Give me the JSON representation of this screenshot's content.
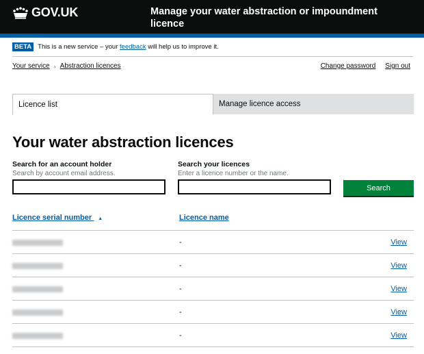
{
  "header": {
    "logo_text": "GOV.UK",
    "service_name": "Manage your water abstraction or impoundment licence"
  },
  "phase_banner": {
    "tag": "BETA",
    "text_before": "This is a new service – your",
    "link": "feedback",
    "text_after": "will help us to improve it."
  },
  "breadcrumbs": [
    "Your service",
    "Abstraction licences"
  ],
  "account_links": {
    "change_password": "Change password",
    "sign_out": "Sign out"
  },
  "tabs": [
    {
      "label": "Licence list",
      "active": true
    },
    {
      "label": "Manage licence access",
      "active": false
    }
  ],
  "page_title": "Your water abstraction licences",
  "search": {
    "account_label": "Search for an account holder",
    "account_hint": "Search by account email address.",
    "account_value": "",
    "licence_label": "Search your licences",
    "licence_hint": "Enter a licence number or the name.",
    "licence_value": "",
    "button_label": "Search"
  },
  "table": {
    "columns": [
      "Licence serial number",
      "Licence name"
    ],
    "sort_indicator": "▲",
    "rows": [
      {
        "licence_name": "-",
        "action": "View"
      },
      {
        "licence_name": "-",
        "action": "View"
      },
      {
        "licence_name": "-",
        "action": "View"
      },
      {
        "licence_name": "-",
        "action": "View"
      },
      {
        "licence_name": "-",
        "action": "View"
      }
    ]
  },
  "colors": {
    "header_bg": "#0b0c0c",
    "accent_blue": "#005ea5",
    "button_green": "#00823b"
  },
  "icons": {
    "logo": "crown-icon",
    "breadcrumb_separator": "chevron-right-icon",
    "sort": "sort-ascending-icon"
  }
}
